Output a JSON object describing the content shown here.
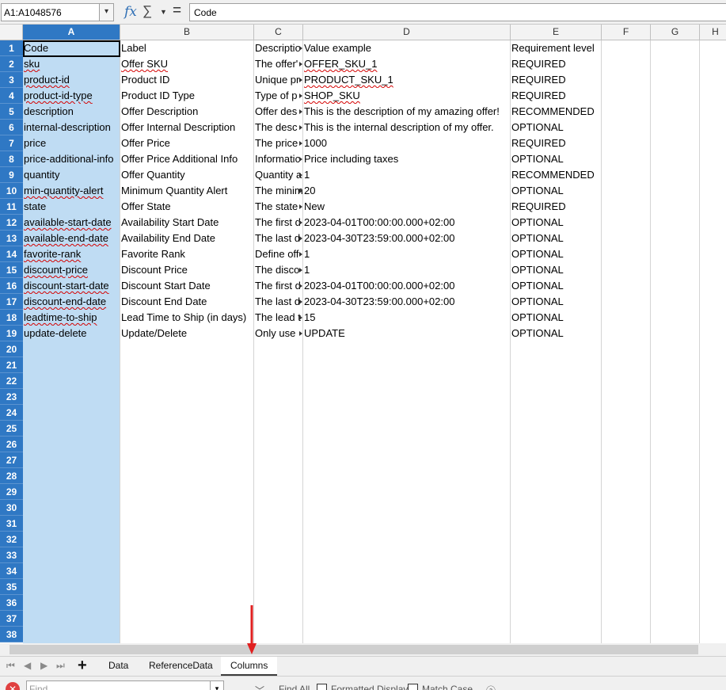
{
  "formula_bar": {
    "name_box": "A1:A1048576",
    "name_box_dropdown_icon": "chevron-down-icon",
    "function_wizard_icon": "fx-icon",
    "sum_icon": "sigma-icon",
    "sum_dropdown_icon": "triangle-down-icon",
    "formula_icon": "equals-icon",
    "formula": "Code"
  },
  "columns": [
    "A",
    "B",
    "C",
    "D",
    "E",
    "F",
    "G",
    "H"
  ],
  "row_numbers": [
    "1",
    "2",
    "3",
    "4",
    "5",
    "6",
    "7",
    "8",
    "9",
    "10",
    "11",
    "12",
    "13",
    "14",
    "15",
    "16",
    "17",
    "18",
    "19",
    "20",
    "21",
    "22",
    "23",
    "24",
    "25",
    "26",
    "27",
    "28",
    "29",
    "30",
    "31",
    "32",
    "33",
    "34",
    "35",
    "36",
    "37",
    "38"
  ],
  "rows": [
    {
      "a": "Code",
      "b": "Label",
      "c": "Descriptio",
      "d": "Value example",
      "e": "Requirement level"
    },
    {
      "a": "sku",
      "b": "Offer SKU",
      "c": "The offer'",
      "d": "OFFER_SKU_1",
      "e": "REQUIRED"
    },
    {
      "a": "product-id",
      "b": "Product ID",
      "c": "Unique pr",
      "d": "PRODUCT_SKU_1",
      "e": "REQUIRED"
    },
    {
      "a": "product-id-type",
      "b": "Product ID Type",
      "c": "Type of p",
      "d": "SHOP_SKU",
      "e": "REQUIRED"
    },
    {
      "a": "description",
      "b": "Offer Description",
      "c": "Offer des",
      "d": "This is the description of my amazing offer!",
      "e": "RECOMMENDED"
    },
    {
      "a": "internal-description",
      "b": "Offer Internal Description",
      "c": "The desc",
      "d": "This is the internal description of my offer.",
      "e": "OPTIONAL"
    },
    {
      "a": "price",
      "b": "Offer Price",
      "c": "The price",
      "d": "1000",
      "e": "REQUIRED"
    },
    {
      "a": "price-additional-info",
      "b": "Offer Price Additional Info",
      "c": "Informatic",
      "d": "Price including taxes",
      "e": "OPTIONAL"
    },
    {
      "a": "quantity",
      "b": "Offer Quantity",
      "c": "Quantity a",
      "d": "1",
      "e": "RECOMMENDED"
    },
    {
      "a": "min-quantity-alert",
      "b": "Minimum Quantity Alert",
      "c": "The minim",
      "d": "20",
      "e": "OPTIONAL"
    },
    {
      "a": "state",
      "b": "Offer State",
      "c": "The state",
      "d": "New",
      "e": "REQUIRED"
    },
    {
      "a": "available-start-date",
      "b": "Availability Start Date",
      "c": "The first d",
      "d": "2023-04-01T00:00:00.000+02:00",
      "e": "OPTIONAL"
    },
    {
      "a": "available-end-date",
      "b": "Availability End Date",
      "c": "The last d",
      "d": "2023-04-30T23:59:00.000+02:00",
      "e": "OPTIONAL"
    },
    {
      "a": "favorite-rank",
      "b": "Favorite Rank",
      "c": "Define off",
      "d": "1",
      "e": "OPTIONAL"
    },
    {
      "a": "discount-price",
      "b": "Discount Price",
      "c": "The disco",
      "d": "1",
      "e": "OPTIONAL"
    },
    {
      "a": "discount-start-date",
      "b": "Discount Start Date",
      "c": "The first d",
      "d": "2023-04-01T00:00:00.000+02:00",
      "e": "OPTIONAL"
    },
    {
      "a": "discount-end-date",
      "b": "Discount End Date",
      "c": "The last d",
      "d": "2023-04-30T23:59:00.000+02:00",
      "e": "OPTIONAL"
    },
    {
      "a": "leadtime-to-ship",
      "b": "Lead Time to Ship (in days)",
      "c": "The lead t",
      "d": "15",
      "e": "OPTIONAL"
    },
    {
      "a": "update-delete",
      "b": "Update/Delete",
      "c": "Only use",
      "d": "UPDATE",
      "e": "OPTIONAL"
    }
  ],
  "sheet_tabs": {
    "first_icon": "first-sheet-icon",
    "prev_icon": "prev-sheet-icon",
    "next_icon": "next-sheet-icon",
    "last_icon": "last-sheet-icon",
    "add_icon": "plus-icon",
    "tabs": [
      "Data",
      "ReferenceData",
      "Columns"
    ],
    "active": "Columns"
  },
  "find_bar": {
    "close_icon": "close-icon",
    "placeholder": "Find",
    "find_prev_icon": "chevron-up-icon",
    "find_next_icon": "chevron-down-icon",
    "find_all": "Find All",
    "formatted_display": "Formatted Display",
    "match_case": "Match Case"
  },
  "colors": {
    "selection_header": "#2f78c4",
    "selection_fill": "#bfdcf3",
    "annotation_arrow": "#e02020"
  }
}
